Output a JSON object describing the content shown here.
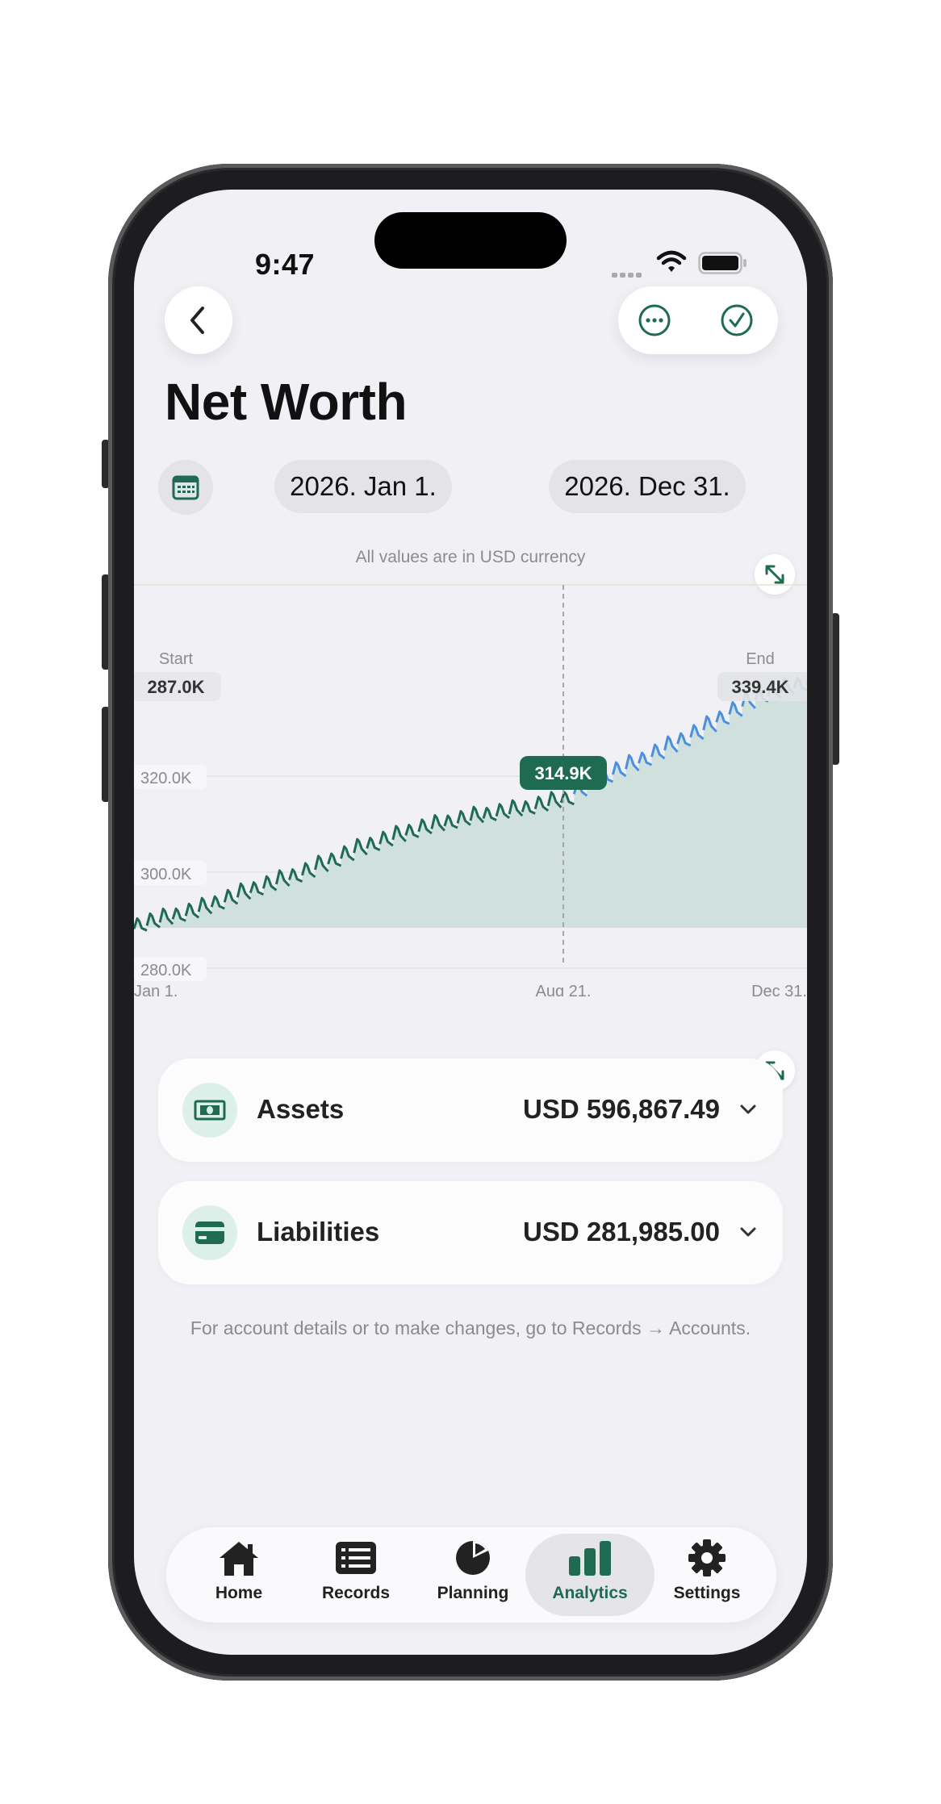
{
  "status_bar": {
    "time": "9:47"
  },
  "header": {
    "title": "Net Worth",
    "start_date": "2026. Jan 1.",
    "end_date": "2026. Dec 31."
  },
  "icons": {
    "back": "chevron-left-icon",
    "more": "ellipsis-circle-icon",
    "done": "checkmark-circle-icon",
    "calendar": "calendar-icon",
    "expand": "expand-arrows-icon"
  },
  "note": "All values are in USD currency",
  "chart": {
    "start_label": "Start",
    "start_value": "287.0K",
    "end_label": "End",
    "end_value": "339.4K",
    "selected_value": "314.9K",
    "y_ticks": [
      "320.0K",
      "300.0K",
      "280.0K"
    ],
    "x_ticks": [
      "Jan 1.",
      "Aug 21.",
      "Dec 31."
    ]
  },
  "chart_data": {
    "type": "area",
    "title": "",
    "xlabel": "",
    "ylabel": "",
    "x_range": [
      "2026-01-01",
      "2026-12-31"
    ],
    "y_ticks": [
      280000,
      300000,
      320000
    ],
    "grid": true,
    "start_value": 287000,
    "end_value": 339400,
    "selected": {
      "x": "2026-08-21",
      "value": 314900
    },
    "series": [
      {
        "points": [
          [
            "2026-01-01",
            288500
          ],
          [
            "2026-02-01",
            291500
          ],
          [
            "2026-03-01",
            295500
          ],
          [
            "2026-04-01",
            299500
          ],
          [
            "2026-05-01",
            304500
          ],
          [
            "2026-06-01",
            308500
          ],
          [
            "2026-07-01",
            311000
          ],
          [
            "2026-08-01",
            313000
          ],
          [
            "2026-08-21",
            314900
          ],
          [
            "2026-09-01",
            318000
          ],
          [
            "2026-10-01",
            323000
          ],
          [
            "2026-11-01",
            329000
          ],
          [
            "2026-12-01",
            336000
          ],
          [
            "2026-12-31",
            339400
          ]
        ]
      }
    ],
    "colors": {
      "past": "#1f6b52",
      "projected": "#4a90e2",
      "fill": "#cfe0dd"
    }
  },
  "cards": [
    {
      "label": "Assets",
      "value": "USD 596,867.49",
      "icon": "banknote-icon"
    },
    {
      "label": "Liabilities",
      "value": "USD 281,985.00",
      "icon": "credit-card-icon"
    }
  ],
  "footnote": "For account details or to make changes, go to Records → Accounts.",
  "tabbar": [
    {
      "label": "Home",
      "icon": "house-icon",
      "active": false
    },
    {
      "label": "Records",
      "icon": "list-icon",
      "active": false
    },
    {
      "label": "Planning",
      "icon": "pie-chart-icon",
      "active": false
    },
    {
      "label": "Analytics",
      "icon": "bar-chart-icon",
      "active": true
    },
    {
      "label": "Settings",
      "icon": "gear-icon",
      "active": false
    }
  ],
  "colors": {
    "accent": "#1f6b52",
    "projection": "#4a90e2",
    "background": "#f1f1f5"
  }
}
